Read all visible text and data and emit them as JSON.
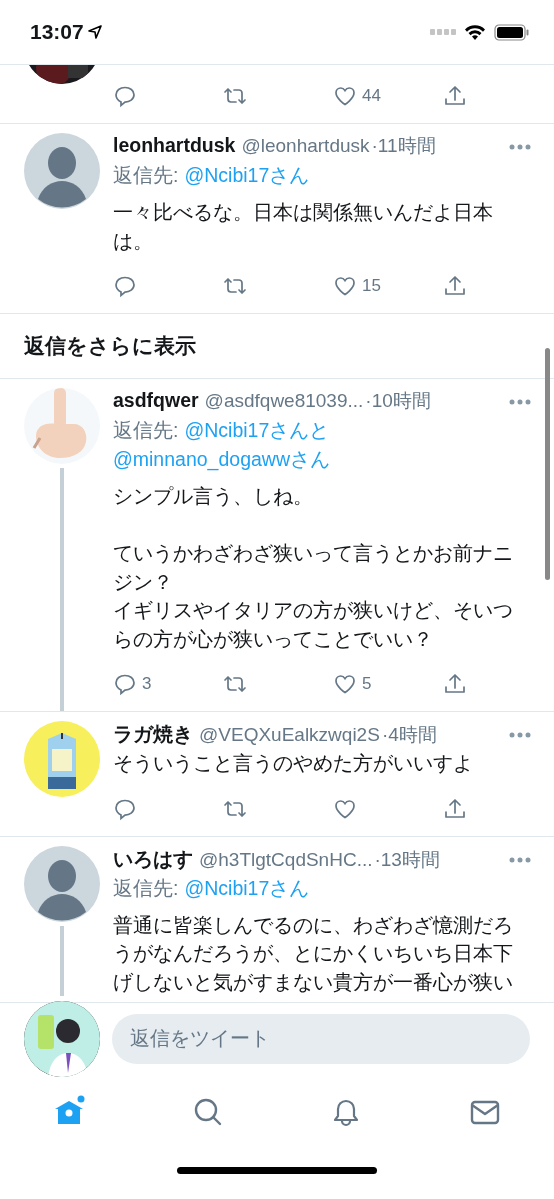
{
  "status_bar": {
    "time": "13:07"
  },
  "tweets": [
    {
      "kind": "partial",
      "avatar": {
        "kind": "picture"
      },
      "actions": {
        "likes": "44"
      }
    },
    {
      "kind": "full",
      "avatar": {
        "kind": "default"
      },
      "name": "leonhartdusk",
      "handle": "@leonhartdusk",
      "time": "·11時間",
      "reply_label": "返信先:",
      "mentions": [
        "@Ncibi17さん"
      ],
      "body": [
        [
          "一々比べるな。日本は関係無いんだよ日本は。"
        ]
      ],
      "actions": {
        "likes": "15"
      }
    },
    {
      "kind": "more",
      "label": "返信をさらに表示"
    },
    {
      "kind": "full",
      "avatar": {
        "kind": "picture"
      },
      "thread": true,
      "name": "asdfqwer",
      "handle": "@asdfqwe81039...",
      "time": "·10時間",
      "reply_label": "返信先:",
      "mentions": [
        "@Ncibi17さんと",
        "@minnano_dogawwさん"
      ],
      "body": [
        [
          "シンプル言う、しね。"
        ],
        [
          "ていうかわざわざ狭いって言うとかお前ナニジン？",
          "イギリスやイタリアの方が狭いけど、そいつらの方が心が狭いってことでいい？"
        ]
      ],
      "actions": {
        "replies": "3",
        "likes": "5"
      }
    },
    {
      "kind": "full",
      "avatar": {
        "kind": "picture"
      },
      "name": "ラガ焼き",
      "handle": "@VEQXuEalkzwqi2S",
      "time": "·4時間",
      "body": [
        [
          "そういうこと言うのやめた方がいいすよ"
        ]
      ]
    },
    {
      "kind": "cut",
      "avatar": {
        "kind": "default"
      },
      "thread": true,
      "name": "いろはす",
      "handle": "@h3TlgtCqdSnHC...",
      "time": "·13時間",
      "reply_label": "返信先:",
      "mentions": [
        "@Ncibi17さん"
      ],
      "body": [
        [
          "普通に皆楽しんでるのに、わざわざ憶測だろうがなんだろうが、とにかくいちいち日本下げしないと気がすまない貴方が一番心が狭い"
        ]
      ]
    }
  ],
  "reply_bar": {
    "placeholder": "返信をツイート"
  },
  "tabs": [
    {
      "kind": "home",
      "selected": true
    },
    {
      "kind": "search",
      "selected": false
    },
    {
      "kind": "notifications",
      "selected": false
    },
    {
      "kind": "messages",
      "selected": false
    }
  ]
}
